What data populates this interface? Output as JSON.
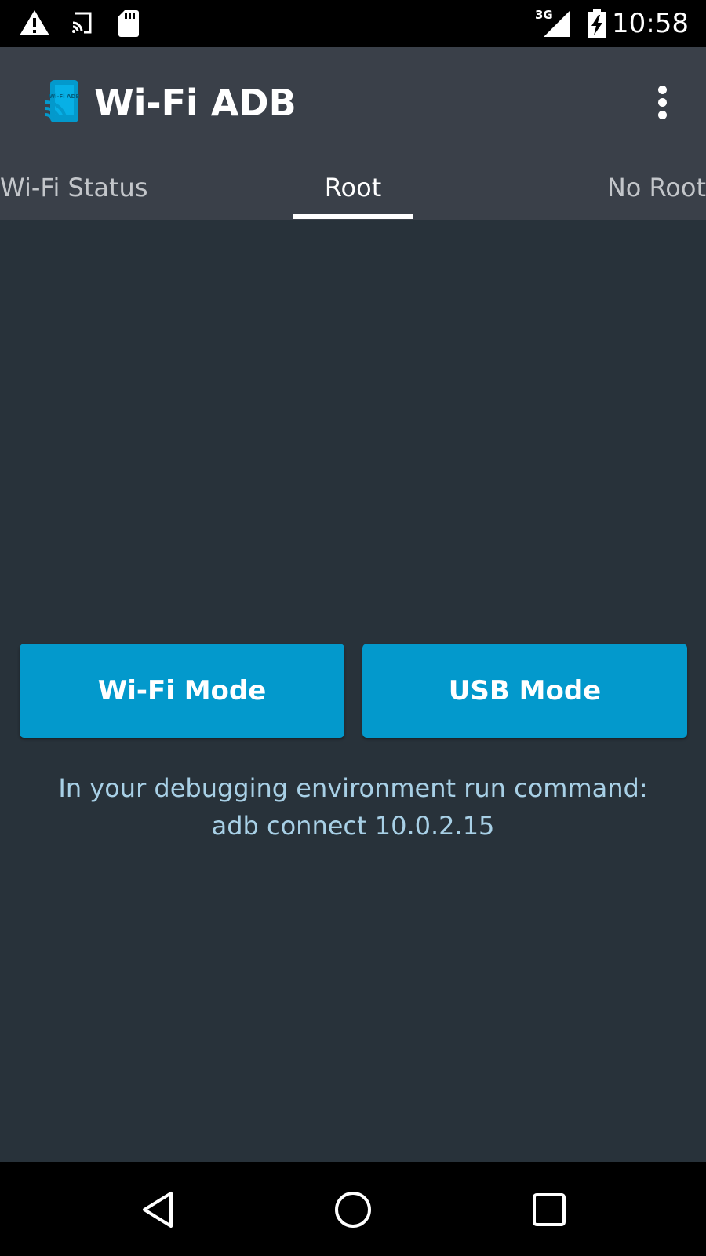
{
  "status_bar": {
    "time": "10:58",
    "network_type": "3G",
    "icons": [
      "warning-icon",
      "cast-icon",
      "sd-card-icon",
      "signal-icon",
      "battery-charging-icon"
    ]
  },
  "app_bar": {
    "title": "Wi-Fi ADB",
    "icon_text": "Wi-Fi ADB",
    "icon": "wifi-adb-app-icon",
    "overflow_icon": "more-vert-icon"
  },
  "tabs": [
    {
      "label": "Wi-Fi Status",
      "selected": false
    },
    {
      "label": "Root",
      "selected": true
    },
    {
      "label": "No Root",
      "selected": false
    }
  ],
  "main": {
    "wifi_mode_label": "Wi-Fi Mode",
    "usb_mode_label": "USB Mode",
    "instruction_line1": "In your debugging environment run command:",
    "instruction_line2": "adb connect 10.0.2.15"
  },
  "nav_bar": {
    "icons": [
      "back-icon",
      "home-icon",
      "recents-icon"
    ]
  },
  "colors": {
    "status_bar": "#000000",
    "app_bar": "#3a4049",
    "content_bg": "#28323a",
    "button": "#0399cc",
    "instruction_text": "#a8d0e6",
    "app_icon": "#0399cc"
  }
}
